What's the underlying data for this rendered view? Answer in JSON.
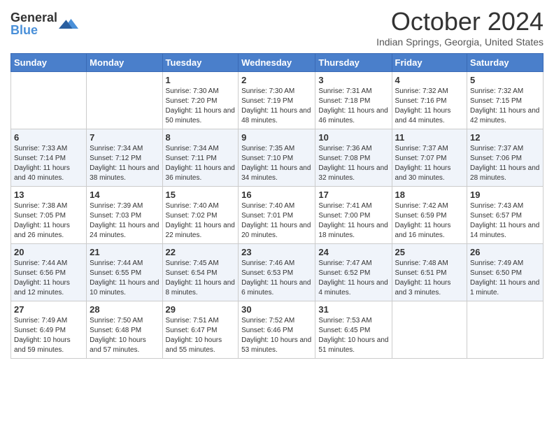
{
  "logo": {
    "general": "General",
    "blue": "Blue"
  },
  "title": "October 2024",
  "location": "Indian Springs, Georgia, United States",
  "days_of_week": [
    "Sunday",
    "Monday",
    "Tuesday",
    "Wednesday",
    "Thursday",
    "Friday",
    "Saturday"
  ],
  "weeks": [
    [
      {
        "day": "",
        "content": ""
      },
      {
        "day": "",
        "content": ""
      },
      {
        "day": "1",
        "content": "Sunrise: 7:30 AM\nSunset: 7:20 PM\nDaylight: 11 hours and 50 minutes."
      },
      {
        "day": "2",
        "content": "Sunrise: 7:30 AM\nSunset: 7:19 PM\nDaylight: 11 hours and 48 minutes."
      },
      {
        "day": "3",
        "content": "Sunrise: 7:31 AM\nSunset: 7:18 PM\nDaylight: 11 hours and 46 minutes."
      },
      {
        "day": "4",
        "content": "Sunrise: 7:32 AM\nSunset: 7:16 PM\nDaylight: 11 hours and 44 minutes."
      },
      {
        "day": "5",
        "content": "Sunrise: 7:32 AM\nSunset: 7:15 PM\nDaylight: 11 hours and 42 minutes."
      }
    ],
    [
      {
        "day": "6",
        "content": "Sunrise: 7:33 AM\nSunset: 7:14 PM\nDaylight: 11 hours and 40 minutes."
      },
      {
        "day": "7",
        "content": "Sunrise: 7:34 AM\nSunset: 7:12 PM\nDaylight: 11 hours and 38 minutes."
      },
      {
        "day": "8",
        "content": "Sunrise: 7:34 AM\nSunset: 7:11 PM\nDaylight: 11 hours and 36 minutes."
      },
      {
        "day": "9",
        "content": "Sunrise: 7:35 AM\nSunset: 7:10 PM\nDaylight: 11 hours and 34 minutes."
      },
      {
        "day": "10",
        "content": "Sunrise: 7:36 AM\nSunset: 7:08 PM\nDaylight: 11 hours and 32 minutes."
      },
      {
        "day": "11",
        "content": "Sunrise: 7:37 AM\nSunset: 7:07 PM\nDaylight: 11 hours and 30 minutes."
      },
      {
        "day": "12",
        "content": "Sunrise: 7:37 AM\nSunset: 7:06 PM\nDaylight: 11 hours and 28 minutes."
      }
    ],
    [
      {
        "day": "13",
        "content": "Sunrise: 7:38 AM\nSunset: 7:05 PM\nDaylight: 11 hours and 26 minutes."
      },
      {
        "day": "14",
        "content": "Sunrise: 7:39 AM\nSunset: 7:03 PM\nDaylight: 11 hours and 24 minutes."
      },
      {
        "day": "15",
        "content": "Sunrise: 7:40 AM\nSunset: 7:02 PM\nDaylight: 11 hours and 22 minutes."
      },
      {
        "day": "16",
        "content": "Sunrise: 7:40 AM\nSunset: 7:01 PM\nDaylight: 11 hours and 20 minutes."
      },
      {
        "day": "17",
        "content": "Sunrise: 7:41 AM\nSunset: 7:00 PM\nDaylight: 11 hours and 18 minutes."
      },
      {
        "day": "18",
        "content": "Sunrise: 7:42 AM\nSunset: 6:59 PM\nDaylight: 11 hours and 16 minutes."
      },
      {
        "day": "19",
        "content": "Sunrise: 7:43 AM\nSunset: 6:57 PM\nDaylight: 11 hours and 14 minutes."
      }
    ],
    [
      {
        "day": "20",
        "content": "Sunrise: 7:44 AM\nSunset: 6:56 PM\nDaylight: 11 hours and 12 minutes."
      },
      {
        "day": "21",
        "content": "Sunrise: 7:44 AM\nSunset: 6:55 PM\nDaylight: 11 hours and 10 minutes."
      },
      {
        "day": "22",
        "content": "Sunrise: 7:45 AM\nSunset: 6:54 PM\nDaylight: 11 hours and 8 minutes."
      },
      {
        "day": "23",
        "content": "Sunrise: 7:46 AM\nSunset: 6:53 PM\nDaylight: 11 hours and 6 minutes."
      },
      {
        "day": "24",
        "content": "Sunrise: 7:47 AM\nSunset: 6:52 PM\nDaylight: 11 hours and 4 minutes."
      },
      {
        "day": "25",
        "content": "Sunrise: 7:48 AM\nSunset: 6:51 PM\nDaylight: 11 hours and 3 minutes."
      },
      {
        "day": "26",
        "content": "Sunrise: 7:49 AM\nSunset: 6:50 PM\nDaylight: 11 hours and 1 minute."
      }
    ],
    [
      {
        "day": "27",
        "content": "Sunrise: 7:49 AM\nSunset: 6:49 PM\nDaylight: 10 hours and 59 minutes."
      },
      {
        "day": "28",
        "content": "Sunrise: 7:50 AM\nSunset: 6:48 PM\nDaylight: 10 hours and 57 minutes."
      },
      {
        "day": "29",
        "content": "Sunrise: 7:51 AM\nSunset: 6:47 PM\nDaylight: 10 hours and 55 minutes."
      },
      {
        "day": "30",
        "content": "Sunrise: 7:52 AM\nSunset: 6:46 PM\nDaylight: 10 hours and 53 minutes."
      },
      {
        "day": "31",
        "content": "Sunrise: 7:53 AM\nSunset: 6:45 PM\nDaylight: 10 hours and 51 minutes."
      },
      {
        "day": "",
        "content": ""
      },
      {
        "day": "",
        "content": ""
      }
    ]
  ]
}
